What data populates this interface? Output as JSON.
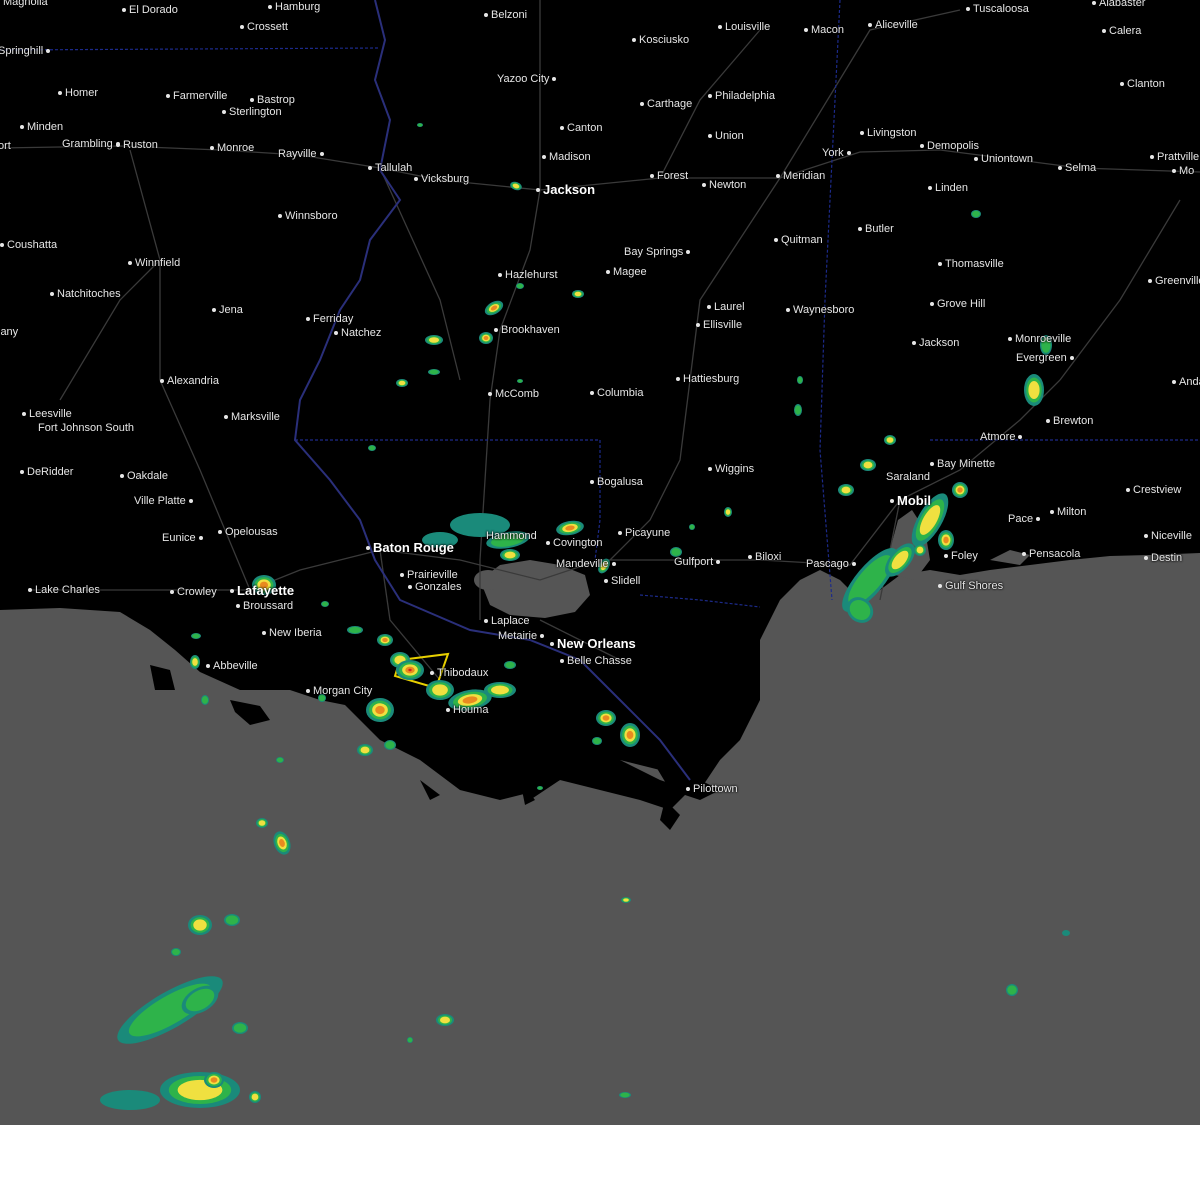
{
  "map": {
    "colors": {
      "land": "#000000",
      "water": "#555555",
      "roads": "#3a3a3a",
      "state_borders": "#1c2a8a",
      "rivers": "#2a2f7a",
      "warning_polygon": "#e8d000",
      "radar_light": "#1a8a7a",
      "radar_green": "#2eb34a",
      "radar_yellow": "#f0e040",
      "radar_orange": "#e88a20",
      "radar_red": "#d02020"
    },
    "cities": [
      {
        "name": "Magnolia",
        "dotSide": "left"
      },
      {
        "name": "El Dorado",
        "dotSide": "left"
      },
      {
        "name": "Hamburg",
        "dotSide": "left"
      },
      {
        "name": "Crossett",
        "dotSide": "left"
      },
      {
        "name": "Belzoni",
        "dotSide": "left"
      },
      {
        "name": "Louisville",
        "dotSide": "left"
      },
      {
        "name": "Macon",
        "dotSide": "left"
      },
      {
        "name": "Aliceville",
        "dotSide": "left"
      },
      {
        "name": "Tuscaloosa",
        "dotSide": "left"
      },
      {
        "name": "Alabaster",
        "dotSide": "left"
      },
      {
        "name": "Springhill",
        "dotSide": "right"
      },
      {
        "name": "Kosciusko",
        "dotSide": "left"
      },
      {
        "name": "Calera",
        "dotSide": "left"
      },
      {
        "name": "Yazoo City",
        "dotSide": "right"
      },
      {
        "name": "Homer",
        "dotSide": "left"
      },
      {
        "name": "Farmerville",
        "dotSide": "left"
      },
      {
        "name": "Bastrop",
        "dotSide": "left"
      },
      {
        "name": "Sterlington",
        "dotSide": "left"
      },
      {
        "name": "Carthage",
        "dotSide": "left"
      },
      {
        "name": "Philadelphia",
        "dotSide": "left"
      },
      {
        "name": "Clanton",
        "dotSide": "left"
      },
      {
        "name": "Minden",
        "dotSide": "left"
      },
      {
        "name": "Canton",
        "dotSide": "left"
      },
      {
        "name": "Livingston",
        "dotSide": "left"
      },
      {
        "name": "Grambling",
        "dotSide": "right"
      },
      {
        "name": "Ruston",
        "dotSide": "left"
      },
      {
        "name": "Monroe",
        "dotSide": "left"
      },
      {
        "name": "Rayville",
        "dotSide": "right"
      },
      {
        "name": "Union",
        "dotSide": "left"
      },
      {
        "name": "Demopolis",
        "dotSide": "left"
      },
      {
        "name": "ort",
        "dotSide": "none"
      },
      {
        "name": "Madison",
        "dotSide": "left"
      },
      {
        "name": "York",
        "dotSide": "right"
      },
      {
        "name": "Uniontown",
        "dotSide": "left"
      },
      {
        "name": "Prattville",
        "dotSide": "left"
      },
      {
        "name": "Tallulah",
        "dotSide": "left"
      },
      {
        "name": "Vicksburg",
        "dotSide": "left"
      },
      {
        "name": "Forest",
        "dotSide": "left"
      },
      {
        "name": "Meridian",
        "dotSide": "left"
      },
      {
        "name": "Selma",
        "dotSide": "left"
      },
      {
        "name": "Mo",
        "dotSide": "left"
      },
      {
        "name": "Jackson",
        "dotSide": "left",
        "major": true
      },
      {
        "name": "Newton",
        "dotSide": "left"
      },
      {
        "name": "Linden",
        "dotSide": "left"
      },
      {
        "name": "Winnsboro",
        "dotSide": "left"
      },
      {
        "name": "Butler",
        "dotSide": "left"
      },
      {
        "name": "Quitman",
        "dotSide": "left"
      },
      {
        "name": "Coushatta",
        "dotSide": "left"
      },
      {
        "name": "Bay Springs",
        "dotSide": "right"
      },
      {
        "name": "Winnfield",
        "dotSide": "left"
      },
      {
        "name": "Hazlehurst",
        "dotSide": "left"
      },
      {
        "name": "Magee",
        "dotSide": "left"
      },
      {
        "name": "Thomasville",
        "dotSide": "left"
      },
      {
        "name": "Natchitoches",
        "dotSide": "left"
      },
      {
        "name": "Greenville",
        "dotSide": "left"
      },
      {
        "name": "Laurel",
        "dotSide": "left"
      },
      {
        "name": "Jena",
        "dotSide": "left"
      },
      {
        "name": "Grove Hill",
        "dotSide": "left"
      },
      {
        "name": "Ferriday",
        "dotSide": "left"
      },
      {
        "name": "Waynesboro",
        "dotSide": "left"
      },
      {
        "name": "Natchez",
        "dotSide": "left"
      },
      {
        "name": "Brookhaven",
        "dotSide": "left"
      },
      {
        "name": "Ellisville",
        "dotSide": "left"
      },
      {
        "name": "lany",
        "dotSide": "none"
      },
      {
        "name": "Jackson",
        "dotSide": "left"
      },
      {
        "name": "Monroeville",
        "dotSide": "left"
      },
      {
        "name": "Evergreen",
        "dotSide": "right"
      },
      {
        "name": "Alexandria",
        "dotSide": "left"
      },
      {
        "name": "Hattiesburg",
        "dotSide": "left"
      },
      {
        "name": "Andalusia",
        "dotSide": "left"
      },
      {
        "name": "Marksville",
        "dotSide": "left"
      },
      {
        "name": "Columbia",
        "dotSide": "left"
      },
      {
        "name": "McComb",
        "dotSide": "left"
      },
      {
        "name": "Leesville",
        "dotSide": "left"
      },
      {
        "name": "Brewton",
        "dotSide": "left"
      },
      {
        "name": "Fort Johnson South",
        "dotSide": "none"
      },
      {
        "name": "Atmore",
        "dotSide": "right"
      },
      {
        "name": "DeRidder",
        "dotSide": "left"
      },
      {
        "name": "Wiggins",
        "dotSide": "left"
      },
      {
        "name": "Oakdale",
        "dotSide": "left"
      },
      {
        "name": "Bay Minette",
        "dotSide": "left"
      },
      {
        "name": "Saraland",
        "dotSide": "none"
      },
      {
        "name": "Bogalusa",
        "dotSide": "left"
      },
      {
        "name": "Crestview",
        "dotSide": "left"
      },
      {
        "name": "Ville Platte",
        "dotSide": "right"
      },
      {
        "name": "Mobil",
        "dotSide": "left",
        "major": true
      },
      {
        "name": "Milton",
        "dotSide": "left"
      },
      {
        "name": "Pace",
        "dotSide": "right"
      },
      {
        "name": "Niceville",
        "dotSide": "left"
      },
      {
        "name": "Opelousas",
        "dotSide": "left"
      },
      {
        "name": "Picayune",
        "dotSide": "left"
      },
      {
        "name": "Eunice",
        "dotSide": "right"
      },
      {
        "name": "Hammond",
        "dotSide": "none"
      },
      {
        "name": "Covington",
        "dotSide": "left"
      },
      {
        "name": "Baton Rouge",
        "dotSide": "left",
        "major": true
      },
      {
        "name": "Foley",
        "dotSide": "left"
      },
      {
        "name": "Pensacola",
        "dotSide": "left"
      },
      {
        "name": "Destin",
        "dotSide": "left"
      },
      {
        "name": "Mandeville",
        "dotSide": "right"
      },
      {
        "name": "Gulfport",
        "dotSide": "right"
      },
      {
        "name": "Biloxi",
        "dotSide": "left"
      },
      {
        "name": "Pascago",
        "dotSide": "right"
      },
      {
        "name": "Slidell",
        "dotSide": "left"
      },
      {
        "name": "Prairieville",
        "dotSide": "left"
      },
      {
        "name": "Gulf Shores",
        "dotSide": "left"
      },
      {
        "name": "Lake Charles",
        "dotSide": "left"
      },
      {
        "name": "Crowley",
        "dotSide": "left"
      },
      {
        "name": "Lafayette",
        "dotSide": "left",
        "major": true
      },
      {
        "name": "Gonzales",
        "dotSide": "left"
      },
      {
        "name": "Broussard",
        "dotSide": "left"
      },
      {
        "name": "Laplace",
        "dotSide": "left"
      },
      {
        "name": "Abbeville",
        "dotSide": "left"
      },
      {
        "name": "New Iberia",
        "dotSide": "left"
      },
      {
        "name": "Metairie",
        "dotSide": "right"
      },
      {
        "name": "New Orleans",
        "dotSide": "left",
        "major": true
      },
      {
        "name": "Belle Chasse",
        "dotSide": "left"
      },
      {
        "name": "Thibodaux",
        "dotSide": "left"
      },
      {
        "name": "Morgan City",
        "dotSide": "left"
      },
      {
        "name": "Houma",
        "dotSide": "left"
      },
      {
        "name": "Pilottown",
        "dotSide": "left"
      }
    ]
  }
}
